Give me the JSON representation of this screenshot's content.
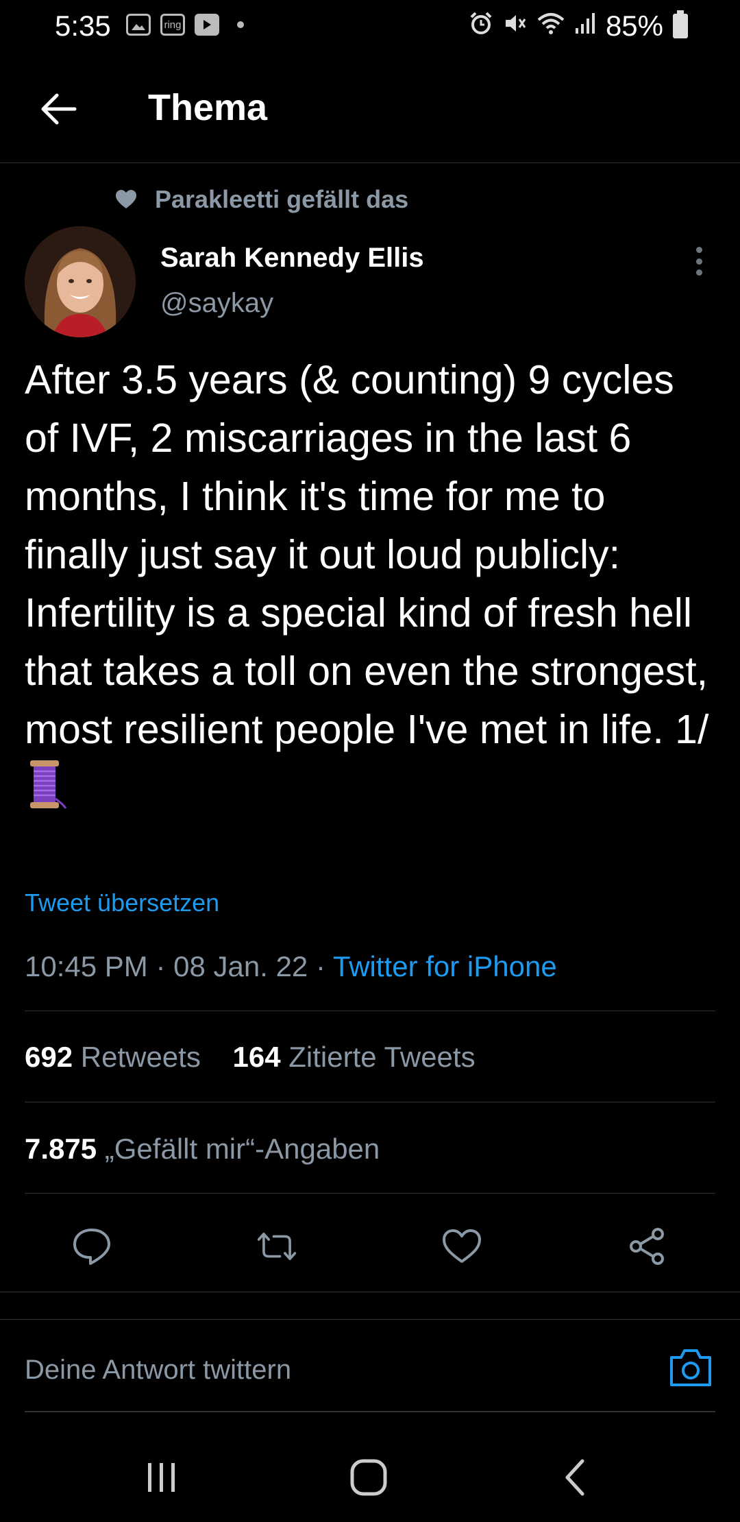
{
  "status_bar": {
    "time": "5:35",
    "notif_icons": [
      "image-icon",
      "ring-icon",
      "youtube-icon"
    ],
    "ring_label": "ring",
    "battery": "85%"
  },
  "header": {
    "title": "Thema"
  },
  "tweet": {
    "social_context": "Parakleetti gefällt das",
    "author_name": "Sarah Kennedy Ellis",
    "author_handle": "@saykay",
    "text": "After 3.5 years (& counting) 9 cycles of IVF, 2 miscarriages in the last 6 months, I think it's time for me to finally just say it out loud publicly: Infertility is a special kind of fresh hell that takes a toll on even the strongest, most resilient people I've met in life. 1/",
    "translate_label": "Tweet übersetzen",
    "time": "10:45 PM",
    "date": "08 Jan. 22",
    "source": "Twitter for iPhone",
    "separator": "·",
    "retweets_count": "692",
    "retweets_label": "Retweets",
    "quotes_count": "164",
    "quotes_label": "Zitierte Tweets",
    "likes_count": "7.875",
    "likes_label": "„Gefällt mir“-Angaben"
  },
  "reply": {
    "placeholder": "Deine Antwort twittern"
  },
  "colors": {
    "background": "#000000",
    "accent": "#1d9bf0",
    "secondary_text": "#8b98a5",
    "divider": "#2f3336"
  }
}
